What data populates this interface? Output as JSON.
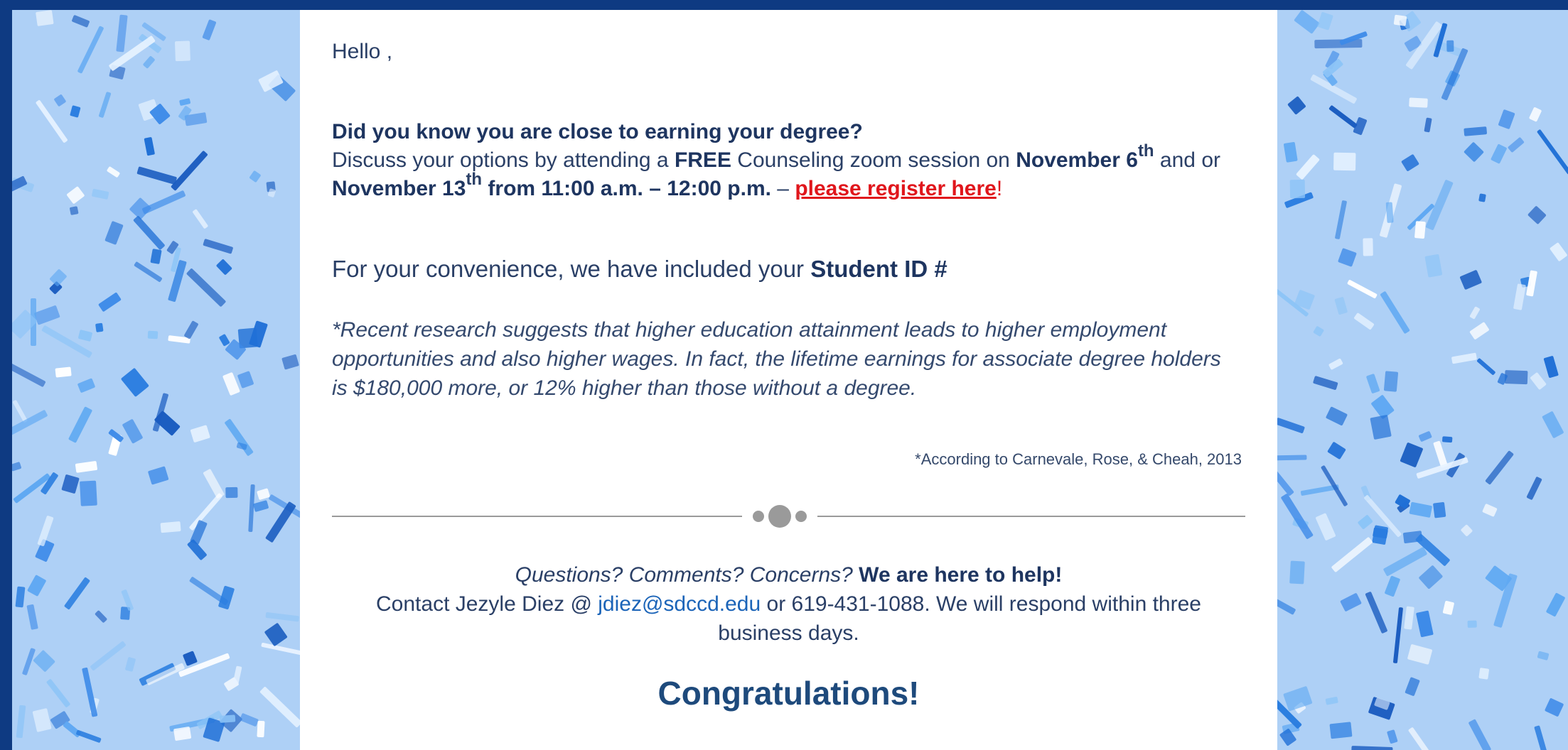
{
  "email": {
    "greeting": "Hello ,",
    "headline": "Did you know you are close to earning your degree?",
    "line2_prefix": "Discuss your options by attending a ",
    "free": "FREE",
    "line2_mid": " Counseling zoom session on ",
    "date1": "November 6",
    "date1_sup": "th",
    "and_or": " and or ",
    "date2": "November 13",
    "date2_sup": "th",
    "time": " from 11:00 a.m. – 12:00 p.m.",
    "dash": " – ",
    "register_link": "please register here",
    "excl": "!",
    "convenience_prefix": "For your convenience, we have included your ",
    "student_id": "Student ID #",
    "research": "*Recent research suggests that higher education attainment leads to higher employment opportunities and also higher wages. In fact, the lifetime earnings for associate degree holders is $180,000 more, or 12% higher than those without a degree.",
    "citation": "*According to Carnevale, Rose, & Cheah, 2013",
    "questions": "Questions? Comments? Concerns?",
    "help": " We are here to help!",
    "contact_prefix": "Contact Jezyle Diez @ ",
    "contact_email": "jdiez@sdccd.edu",
    "contact_suffix": " or 619-431-1088. We will respond within three business days.",
    "congrats": "Congratulations!"
  },
  "colors": {
    "frame": "#0e3a82",
    "confetti_bg": "#aed0f6",
    "link_red": "#e0161c",
    "link_blue": "#1b64b8",
    "heading_navy": "#1e4a7c"
  }
}
